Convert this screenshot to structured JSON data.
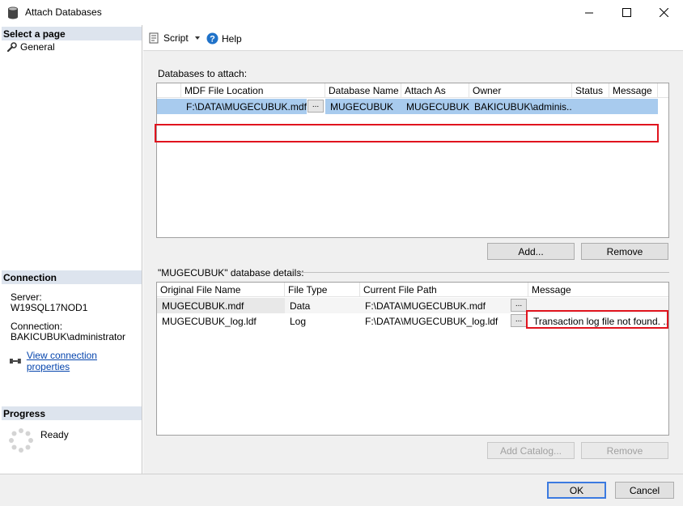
{
  "window": {
    "title": "Attach Databases"
  },
  "left": {
    "select_page_header": "Select a page",
    "pages": [
      {
        "label": "General"
      }
    ],
    "connection_header": "Connection",
    "server_label": "Server:",
    "server_value": "W19SQL17NOD1",
    "connection_label": "Connection:",
    "connection_value": "BAKICUBUK\\administrator",
    "view_props_link": "View connection properties",
    "progress_header": "Progress",
    "progress_status": "Ready"
  },
  "toolbar": {
    "script_label": "Script",
    "help_label": "Help"
  },
  "attach": {
    "label": "Databases to attach:",
    "columns": [
      "MDF File Location",
      "Database Name",
      "Attach As",
      "Owner",
      "Status",
      "Message"
    ],
    "rows": [
      {
        "mdf": "F:\\DATA\\MUGECUBUK.mdf",
        "db_name": "MUGECUBUK",
        "attach_as": "MUGECUBUK",
        "owner": "BAKICUBUK\\adminis...",
        "status": "",
        "message": ""
      }
    ],
    "add_label": "Add...",
    "remove_label": "Remove"
  },
  "details": {
    "label": "\"MUGECUBUK\" database details:",
    "columns": [
      "Original File Name",
      "File Type",
      "Current File Path",
      "Message"
    ],
    "rows": [
      {
        "name": "MUGECUBUK.mdf",
        "type": "Data",
        "path": "F:\\DATA\\MUGECUBUK.mdf",
        "message": ""
      },
      {
        "name": "MUGECUBUK_log.ldf",
        "type": "Log",
        "path": "F:\\DATA\\MUGECUBUK_log.ldf",
        "message": "Transaction log file not found. ..."
      }
    ],
    "add_catalog_label": "Add Catalog...",
    "remove_label": "Remove"
  },
  "footer": {
    "ok_label": "OK",
    "cancel_label": "Cancel"
  },
  "common": {
    "ellipsis": "..."
  },
  "colors": {
    "highlight": "#e0141e",
    "selection": "#a8cbee",
    "section_header": "#dde4ee",
    "link": "#0645ad"
  }
}
